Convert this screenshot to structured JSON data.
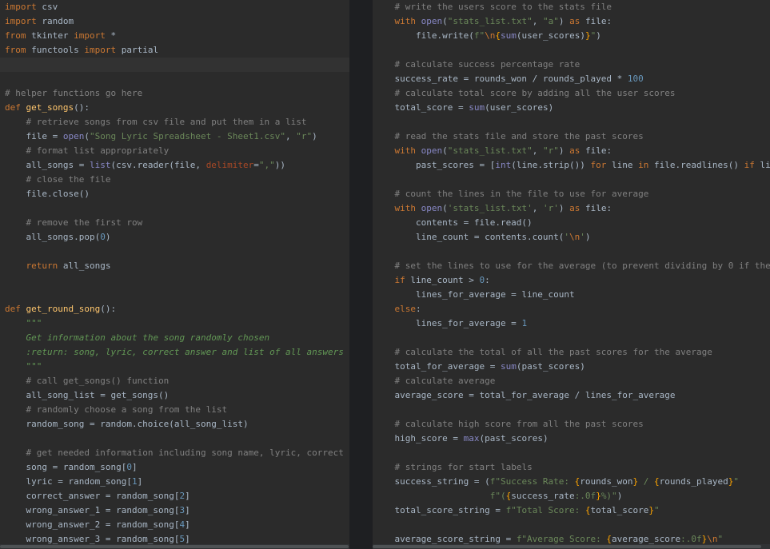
{
  "editor": {
    "left": [
      {
        "t": [
          [
            "k",
            "import"
          ],
          [
            "v",
            " csv"
          ]
        ]
      },
      {
        "t": [
          [
            "k",
            "import"
          ],
          [
            "v",
            " random"
          ]
        ]
      },
      {
        "t": [
          [
            "k",
            "from"
          ],
          [
            "v",
            " tkinter "
          ],
          [
            "k",
            "import"
          ],
          [
            "v",
            " *"
          ]
        ]
      },
      {
        "t": [
          [
            "k",
            "from"
          ],
          [
            "v",
            " functools "
          ],
          [
            "k",
            "import"
          ],
          [
            "v",
            " partial"
          ]
        ]
      },
      {
        "t": [],
        "hl": true
      },
      {
        "t": []
      },
      {
        "t": [
          [
            "c",
            "# helper functions go here"
          ]
        ]
      },
      {
        "t": [
          [
            "k",
            "def "
          ],
          [
            "f",
            "get_songs"
          ],
          [
            "v",
            "():"
          ]
        ]
      },
      {
        "t": [
          [
            "v",
            "    "
          ],
          [
            "c",
            "# retrieve songs from csv file and put them in a list"
          ]
        ]
      },
      {
        "t": [
          [
            "v",
            "    file = "
          ],
          [
            "b",
            "open"
          ],
          [
            "v",
            "("
          ],
          [
            "s",
            "\"Song Lyric Spreadsheet - Sheet1.csv\""
          ],
          [
            "v",
            ", "
          ],
          [
            "s",
            "\"r\""
          ],
          [
            "v",
            ")"
          ]
        ]
      },
      {
        "t": [
          [
            "v",
            "    "
          ],
          [
            "c",
            "# format list appropriately"
          ]
        ]
      },
      {
        "t": [
          [
            "v",
            "    all_songs = "
          ],
          [
            "b",
            "list"
          ],
          [
            "v",
            "(csv.reader(file, "
          ],
          [
            "p",
            "delimiter"
          ],
          [
            "v",
            "="
          ],
          [
            "s",
            "\",\""
          ],
          [
            "v",
            "))"
          ]
        ]
      },
      {
        "t": [
          [
            "v",
            "    "
          ],
          [
            "c",
            "# close the file"
          ]
        ]
      },
      {
        "t": [
          [
            "v",
            "    file.close()"
          ]
        ]
      },
      {
        "t": []
      },
      {
        "t": [
          [
            "v",
            "    "
          ],
          [
            "c",
            "# remove the first row"
          ]
        ]
      },
      {
        "t": [
          [
            "v",
            "    all_songs.pop("
          ],
          [
            "n",
            "0"
          ],
          [
            "v",
            ")"
          ]
        ]
      },
      {
        "t": []
      },
      {
        "t": [
          [
            "v",
            "    "
          ],
          [
            "k",
            "return"
          ],
          [
            "v",
            " all_songs"
          ]
        ]
      },
      {
        "t": []
      },
      {
        "t": []
      },
      {
        "t": [
          [
            "k",
            "def "
          ],
          [
            "f",
            "get_round_song"
          ],
          [
            "v",
            "():"
          ]
        ]
      },
      {
        "t": [
          [
            "v",
            "    "
          ],
          [
            "d",
            "\"\"\""
          ]
        ]
      },
      {
        "t": [
          [
            "v",
            "    "
          ],
          [
            "d",
            "Get information about the song randomly chosen"
          ]
        ]
      },
      {
        "t": [
          [
            "v",
            "    "
          ],
          [
            "d",
            ":return: song, lyric, correct answer and list of all answers"
          ]
        ]
      },
      {
        "t": [
          [
            "v",
            "    "
          ],
          [
            "d",
            "\"\"\""
          ]
        ]
      },
      {
        "t": [
          [
            "v",
            "    "
          ],
          [
            "c",
            "# call get_songs() function"
          ]
        ]
      },
      {
        "t": [
          [
            "v",
            "    all_song_list = get_songs()"
          ]
        ]
      },
      {
        "t": [
          [
            "v",
            "    "
          ],
          [
            "c",
            "# randomly choose a song from the list"
          ]
        ]
      },
      {
        "t": [
          [
            "v",
            "    random_song = random.choice(all_song_list)"
          ]
        ]
      },
      {
        "t": []
      },
      {
        "t": [
          [
            "v",
            "    "
          ],
          [
            "c",
            "# get needed information including song name, lyric, correct a"
          ]
        ]
      },
      {
        "t": [
          [
            "v",
            "    song = random_song["
          ],
          [
            "n",
            "0"
          ],
          [
            "v",
            "]"
          ]
        ]
      },
      {
        "t": [
          [
            "v",
            "    lyric = random_song["
          ],
          [
            "n",
            "1"
          ],
          [
            "v",
            "]"
          ]
        ]
      },
      {
        "t": [
          [
            "v",
            "    correct_answer = random_song["
          ],
          [
            "n",
            "2"
          ],
          [
            "v",
            "]"
          ]
        ]
      },
      {
        "t": [
          [
            "v",
            "    wrong_answer_1 = random_song["
          ],
          [
            "n",
            "3"
          ],
          [
            "v",
            "]"
          ]
        ]
      },
      {
        "t": [
          [
            "v",
            "    wrong_answer_2 = random_song["
          ],
          [
            "n",
            "4"
          ],
          [
            "v",
            "]"
          ]
        ]
      },
      {
        "t": [
          [
            "v",
            "    wrong_answer_3 = random_song["
          ],
          [
            "n",
            "5"
          ],
          [
            "v",
            "]"
          ]
        ]
      }
    ],
    "right": [
      {
        "t": [
          [
            "v",
            "    "
          ],
          [
            "c",
            "# write the users score to the stats file"
          ]
        ]
      },
      {
        "t": [
          [
            "v",
            "    "
          ],
          [
            "k",
            "with "
          ],
          [
            "b",
            "open"
          ],
          [
            "v",
            "("
          ],
          [
            "s",
            "\"stats_list.txt\""
          ],
          [
            "v",
            ", "
          ],
          [
            "s",
            "\"a\""
          ],
          [
            "v",
            ") "
          ],
          [
            "k",
            "as"
          ],
          [
            "v",
            " file:"
          ]
        ]
      },
      {
        "t": [
          [
            "v",
            "        file.write("
          ],
          [
            "s",
            "f\""
          ],
          [
            "e",
            "\\n"
          ],
          [
            "i",
            "{"
          ],
          [
            "b",
            "sum"
          ],
          [
            "v",
            "(user_scores)"
          ],
          [
            "i",
            "}"
          ],
          [
            "s",
            "\""
          ],
          [
            "v",
            ")"
          ]
        ]
      },
      {
        "t": []
      },
      {
        "t": [
          [
            "v",
            "    "
          ],
          [
            "c",
            "# calculate success percentage rate"
          ]
        ]
      },
      {
        "t": [
          [
            "v",
            "    success_rate = rounds_won / rounds_played * "
          ],
          [
            "n",
            "100"
          ]
        ]
      },
      {
        "t": [
          [
            "v",
            "    "
          ],
          [
            "c",
            "# calculate total score by adding all the user scores"
          ]
        ]
      },
      {
        "t": [
          [
            "v",
            "    total_score = "
          ],
          [
            "b",
            "sum"
          ],
          [
            "v",
            "(user_scores)"
          ]
        ]
      },
      {
        "t": []
      },
      {
        "t": [
          [
            "v",
            "    "
          ],
          [
            "c",
            "# read the stats file and store the past scores"
          ]
        ]
      },
      {
        "t": [
          [
            "v",
            "    "
          ],
          [
            "k",
            "with "
          ],
          [
            "b",
            "open"
          ],
          [
            "v",
            "("
          ],
          [
            "s",
            "\"stats_list.txt\""
          ],
          [
            "v",
            ", "
          ],
          [
            "s",
            "\"r\""
          ],
          [
            "v",
            ") "
          ],
          [
            "k",
            "as"
          ],
          [
            "v",
            " file:"
          ]
        ]
      },
      {
        "t": [
          [
            "v",
            "        past_scores = ["
          ],
          [
            "b",
            "int"
          ],
          [
            "v",
            "(line.strip()) "
          ],
          [
            "k",
            "for"
          ],
          [
            "v",
            " line "
          ],
          [
            "k",
            "in"
          ],
          [
            "v",
            " file.readlines() "
          ],
          [
            "k",
            "if"
          ],
          [
            "v",
            " lin"
          ]
        ]
      },
      {
        "t": []
      },
      {
        "t": [
          [
            "v",
            "    "
          ],
          [
            "c",
            "# count the lines in the file to use for average"
          ]
        ]
      },
      {
        "t": [
          [
            "v",
            "    "
          ],
          [
            "k",
            "with "
          ],
          [
            "b",
            "open"
          ],
          [
            "v",
            "("
          ],
          [
            "s",
            "'stats_list.txt'"
          ],
          [
            "v",
            ", "
          ],
          [
            "s",
            "'r'"
          ],
          [
            "v",
            ") "
          ],
          [
            "k",
            "as"
          ],
          [
            "v",
            " file:"
          ]
        ]
      },
      {
        "t": [
          [
            "v",
            "        contents = file.read()"
          ]
        ]
      },
      {
        "t": [
          [
            "v",
            "        line_count = contents.count("
          ],
          [
            "s",
            "'"
          ],
          [
            "e",
            "\\n"
          ],
          [
            "s",
            "'"
          ],
          [
            "v",
            ")"
          ]
        ]
      },
      {
        "t": []
      },
      {
        "t": [
          [
            "v",
            "    "
          ],
          [
            "c",
            "# set the lines to use for the average (to prevent dividing by 0 if the"
          ]
        ]
      },
      {
        "t": [
          [
            "v",
            "    "
          ],
          [
            "k",
            "if"
          ],
          [
            "v",
            " line_count > "
          ],
          [
            "n",
            "0"
          ],
          [
            "v",
            ":"
          ]
        ]
      },
      {
        "t": [
          [
            "v",
            "        lines_for_average = line_count"
          ]
        ]
      },
      {
        "t": [
          [
            "v",
            "    "
          ],
          [
            "k",
            "else"
          ],
          [
            "v",
            ":"
          ]
        ]
      },
      {
        "t": [
          [
            "v",
            "        lines_for_average = "
          ],
          [
            "n",
            "1"
          ]
        ]
      },
      {
        "t": []
      },
      {
        "t": [
          [
            "v",
            "    "
          ],
          [
            "c",
            "# calculate the total of all the past scores for the average"
          ]
        ]
      },
      {
        "t": [
          [
            "v",
            "    total_for_average = "
          ],
          [
            "b",
            "sum"
          ],
          [
            "v",
            "(past_scores)"
          ]
        ]
      },
      {
        "t": [
          [
            "v",
            "    "
          ],
          [
            "c",
            "# calculate average"
          ]
        ]
      },
      {
        "t": [
          [
            "v",
            "    average_score = total_for_average / lines_for_average"
          ]
        ]
      },
      {
        "t": []
      },
      {
        "t": [
          [
            "v",
            "    "
          ],
          [
            "c",
            "# calculate high score from all the past scores"
          ]
        ]
      },
      {
        "t": [
          [
            "v",
            "    high_score = "
          ],
          [
            "b",
            "max"
          ],
          [
            "v",
            "(past_scores)"
          ]
        ]
      },
      {
        "t": []
      },
      {
        "t": [
          [
            "v",
            "    "
          ],
          [
            "c",
            "# strings for start labels"
          ]
        ]
      },
      {
        "t": [
          [
            "v",
            "    success_string = ("
          ],
          [
            "s",
            "f\"Success Rate: "
          ],
          [
            "i",
            "{"
          ],
          [
            "v",
            "rounds_won"
          ],
          [
            "i",
            "}"
          ],
          [
            "s",
            " / "
          ],
          [
            "i",
            "{"
          ],
          [
            "v",
            "rounds_played"
          ],
          [
            "i",
            "}"
          ],
          [
            "s",
            "\""
          ]
        ]
      },
      {
        "t": [
          [
            "v",
            "                      "
          ],
          [
            "s",
            "f\"("
          ],
          [
            "i",
            "{"
          ],
          [
            "v",
            "success_rate"
          ],
          [
            "s",
            ":.0f"
          ],
          [
            "i",
            "}"
          ],
          [
            "s",
            "%)\""
          ],
          [
            "v",
            ")"
          ]
        ]
      },
      {
        "t": [
          [
            "v",
            "    total_score_string = "
          ],
          [
            "s",
            "f\"Total Score: "
          ],
          [
            "i",
            "{"
          ],
          [
            "v",
            "total_score"
          ],
          [
            "i",
            "}"
          ],
          [
            "s",
            "\""
          ]
        ]
      },
      {
        "t": []
      },
      {
        "t": [
          [
            "v",
            "    average_score_string = "
          ],
          [
            "s",
            "f\"Average Score: "
          ],
          [
            "i",
            "{"
          ],
          [
            "v",
            "average_score"
          ],
          [
            "s",
            ":.0f"
          ],
          [
            "i",
            "}"
          ],
          [
            "e",
            "\\n"
          ],
          [
            "s",
            "\""
          ]
        ]
      }
    ]
  }
}
